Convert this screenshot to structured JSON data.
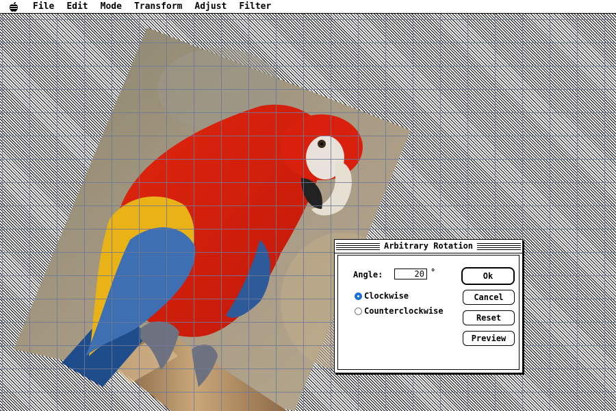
{
  "menubar": {
    "items": [
      "File",
      "Edit",
      "Mode",
      "Transform",
      "Adjust",
      "Filter"
    ]
  },
  "dialog": {
    "title": "Arbitrary Rotation",
    "angle_label": "Angle:",
    "angle_value": "20",
    "degree_symbol": "°",
    "options": [
      {
        "label": "Clockwise",
        "selected": true
      },
      {
        "label": "Counterclockwise",
        "selected": false
      }
    ],
    "buttons": {
      "ok": "Ok",
      "cancel": "Cancel",
      "reset": "Reset",
      "preview": "Preview"
    }
  },
  "colors": {
    "selection_accent": "#1f6fd6",
    "grid": "#6e7896"
  }
}
